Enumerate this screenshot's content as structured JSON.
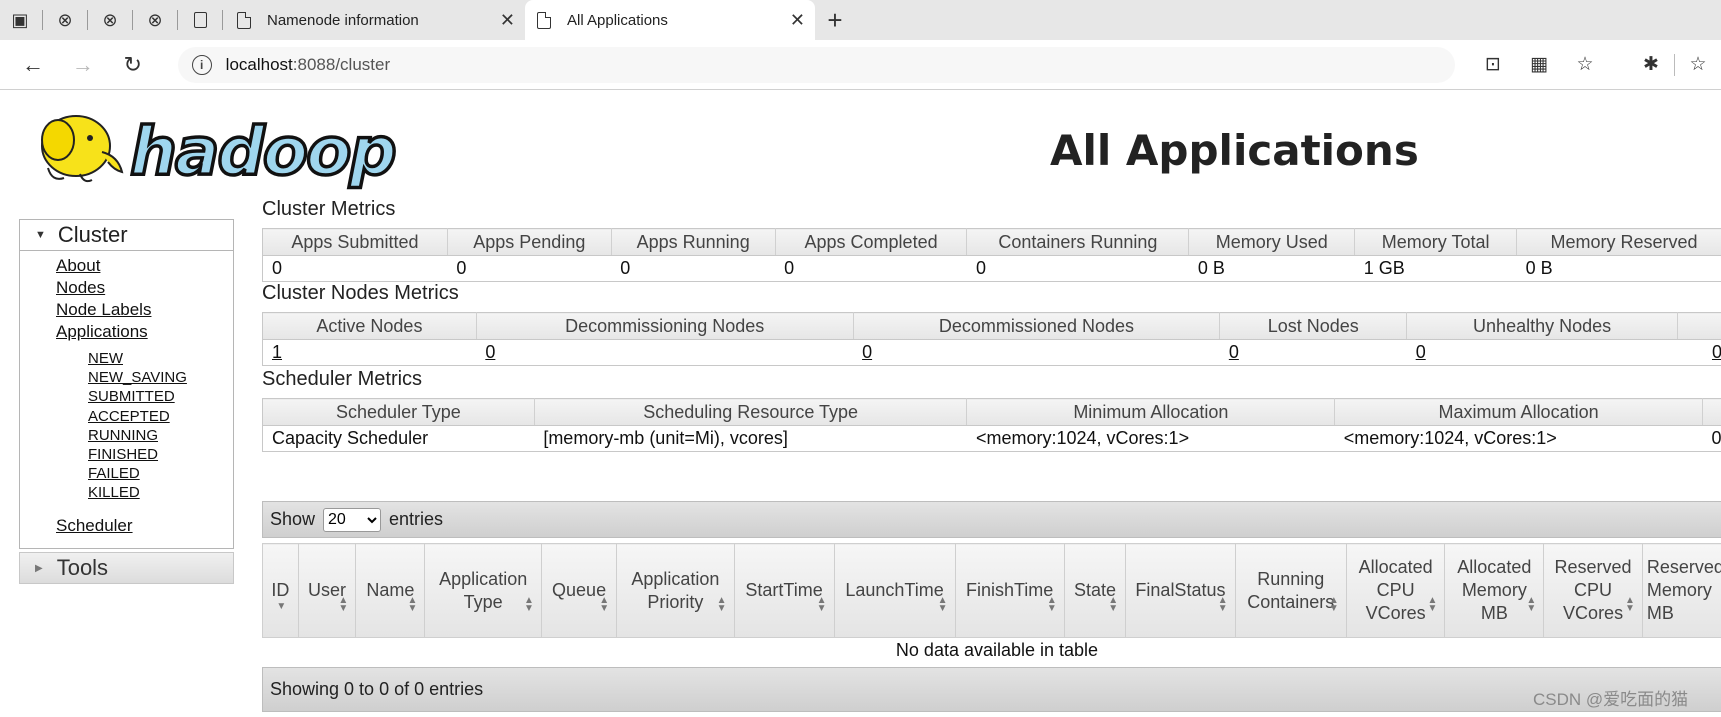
{
  "browser": {
    "tabs": [
      {
        "title": "Namenode information",
        "active": false
      },
      {
        "title": "All Applications",
        "active": true
      }
    ],
    "url_host": "localhost",
    "url_path": ":8088/cluster"
  },
  "page": {
    "logo_text": "hadoop",
    "title": "All Applications"
  },
  "sidebar": {
    "cluster_label": "Cluster",
    "links": {
      "about": "About",
      "nodes": "Nodes",
      "node_labels": "Node Labels",
      "applications": "Applications",
      "scheduler": "Scheduler"
    },
    "app_states": [
      "NEW",
      "NEW_SAVING",
      "SUBMITTED",
      "ACCEPTED",
      "RUNNING",
      "FINISHED",
      "FAILED",
      "KILLED"
    ],
    "tools_label": "Tools"
  },
  "cluster_metrics": {
    "title": "Cluster Metrics",
    "headers": [
      "Apps Submitted",
      "Apps Pending",
      "Apps Running",
      "Apps Completed",
      "Containers Running",
      "Memory Used",
      "Memory Total",
      "Memory Reserved"
    ],
    "values": [
      "0",
      "0",
      "0",
      "0",
      "0",
      "0 B",
      "1 GB",
      "0 B"
    ]
  },
  "node_metrics": {
    "title": "Cluster Nodes Metrics",
    "headers": [
      "Active Nodes",
      "Decommissioning Nodes",
      "Decommissioned Nodes",
      "Lost Nodes",
      "Unhealthy Nodes",
      ""
    ],
    "values": [
      "1",
      "0",
      "0",
      "0",
      "0",
      "0"
    ]
  },
  "scheduler_metrics": {
    "title": "Scheduler Metrics",
    "headers": [
      "Scheduler Type",
      "Scheduling Resource Type",
      "Minimum Allocation",
      "Maximum Allocation",
      ""
    ],
    "values": [
      "Capacity Scheduler",
      "[memory-mb (unit=Mi), vcores]",
      "<memory:1024, vCores:1>",
      "<memory:1024, vCores:1>",
      "0"
    ]
  },
  "apps_table": {
    "show_label": "Show",
    "page_size": "20",
    "entries_label": "entries",
    "columns": [
      "ID",
      "User",
      "Name",
      "Application Type",
      "Queue",
      "Application Priority",
      "StartTime",
      "LaunchTime",
      "FinishTime",
      "State",
      "FinalStatus",
      "Running Containers",
      "Allocated CPU VCores",
      "Allocated Memory MB",
      "Reserved CPU VCores",
      "Reserved Memory MB"
    ],
    "empty_message": "No data available in table",
    "info": "Showing 0 to 0 of 0 entries"
  },
  "watermark": "CSDN @爱吃面的猫"
}
